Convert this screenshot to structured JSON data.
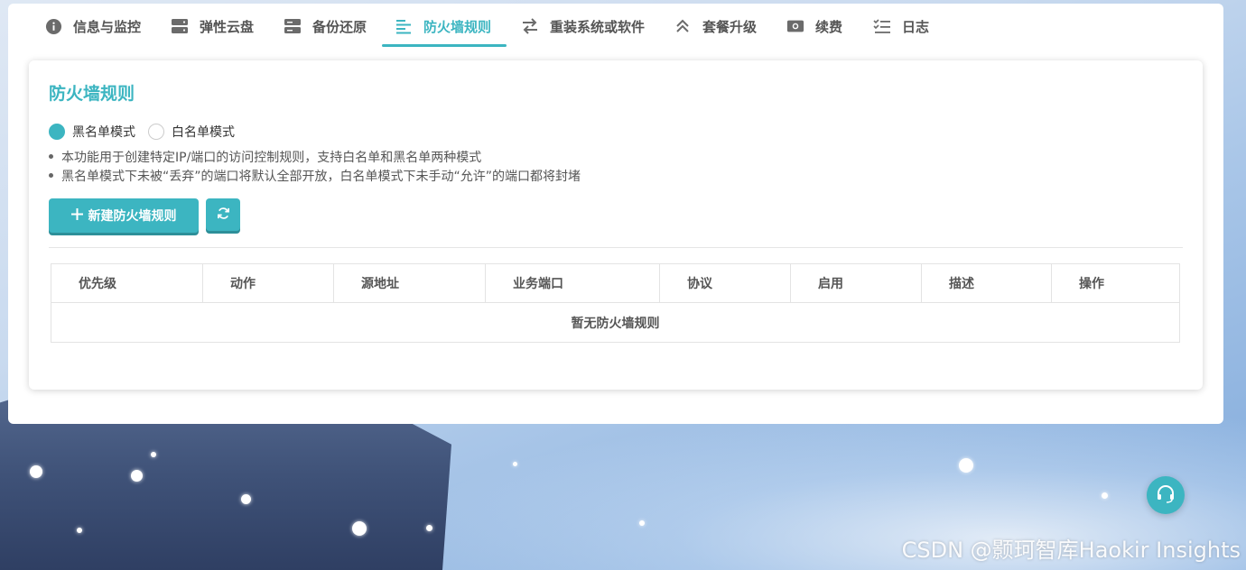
{
  "tabs": [
    {
      "label": "信息与监控",
      "icon": "info-icon",
      "active": false
    },
    {
      "label": "弹性云盘",
      "icon": "disk-icon",
      "active": false
    },
    {
      "label": "备份还原",
      "icon": "backup-icon",
      "active": false
    },
    {
      "label": "防火墙规则",
      "icon": "list-icon",
      "active": true
    },
    {
      "label": "重装系统或软件",
      "icon": "swap-icon",
      "active": false
    },
    {
      "label": "套餐升级",
      "icon": "upgrade-icon",
      "active": false
    },
    {
      "label": "续费",
      "icon": "money-icon",
      "active": false
    },
    {
      "label": "日志",
      "icon": "checklist-icon",
      "active": false
    }
  ],
  "firewall": {
    "title": "防火墙规则",
    "modes": [
      {
        "label": "黑名单模式",
        "checked": true
      },
      {
        "label": "白名单模式",
        "checked": false
      }
    ],
    "notes": [
      "本功能用于创建特定IP/端口的访问控制规则，支持白名单和黑名单两种模式",
      "黑名单模式下未被“丢弃”的端口将默认全部开放，白名单模式下未手动“允许”的端口都将封堵"
    ],
    "new_button_label": "新建防火墙规则",
    "refresh_icon": "refresh-icon",
    "table": {
      "columns": [
        "优先级",
        "动作",
        "源地址",
        "业务端口",
        "协议",
        "启用",
        "描述",
        "操作"
      ],
      "empty_text": "暂无防火墙规则"
    }
  },
  "support_icon": "headset-icon",
  "watermark": "CSDN @颢珂智库Haokir Insights",
  "colors": {
    "accent": "#3cb5c1"
  }
}
